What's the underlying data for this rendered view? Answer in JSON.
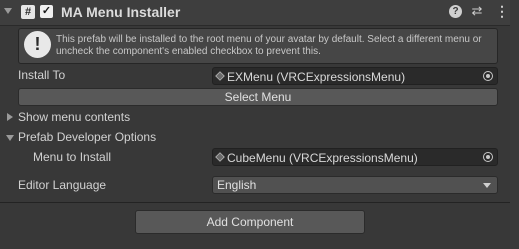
{
  "component": {
    "title": "MA Menu Installer",
    "enabled_check": "✓",
    "hash_glyph": "#",
    "help_glyph": "?",
    "preset_glyph": "⇄",
    "kebab_glyph": "⋮"
  },
  "info": {
    "glyph": "!",
    "text": "This prefab will be installed to the root menu of your avatar by default. Select a different menu or uncheck the component's enabled checkbox to prevent this."
  },
  "install_to": {
    "label": "Install To",
    "value": "EXMenu (VRCExpressionsMenu)"
  },
  "select_menu_button": "Select Menu",
  "show_menu_contents": "Show menu contents",
  "prefab_dev": {
    "label": "Prefab Developer Options",
    "menu_to_install_label": "Menu to Install",
    "menu_to_install_value": "CubeMenu (VRCExpressionsMenu)"
  },
  "editor_language": {
    "label": "Editor Language",
    "value": "English"
  },
  "add_component_button": "Add Component",
  "icons": {
    "fold": "chevron-down-icon",
    "component": "script-icon",
    "help": "help-icon",
    "preset": "preset-icon",
    "menu": "kebab-menu-icon",
    "info": "info-icon",
    "object": "cube-icon",
    "picker": "object-picker-icon"
  }
}
